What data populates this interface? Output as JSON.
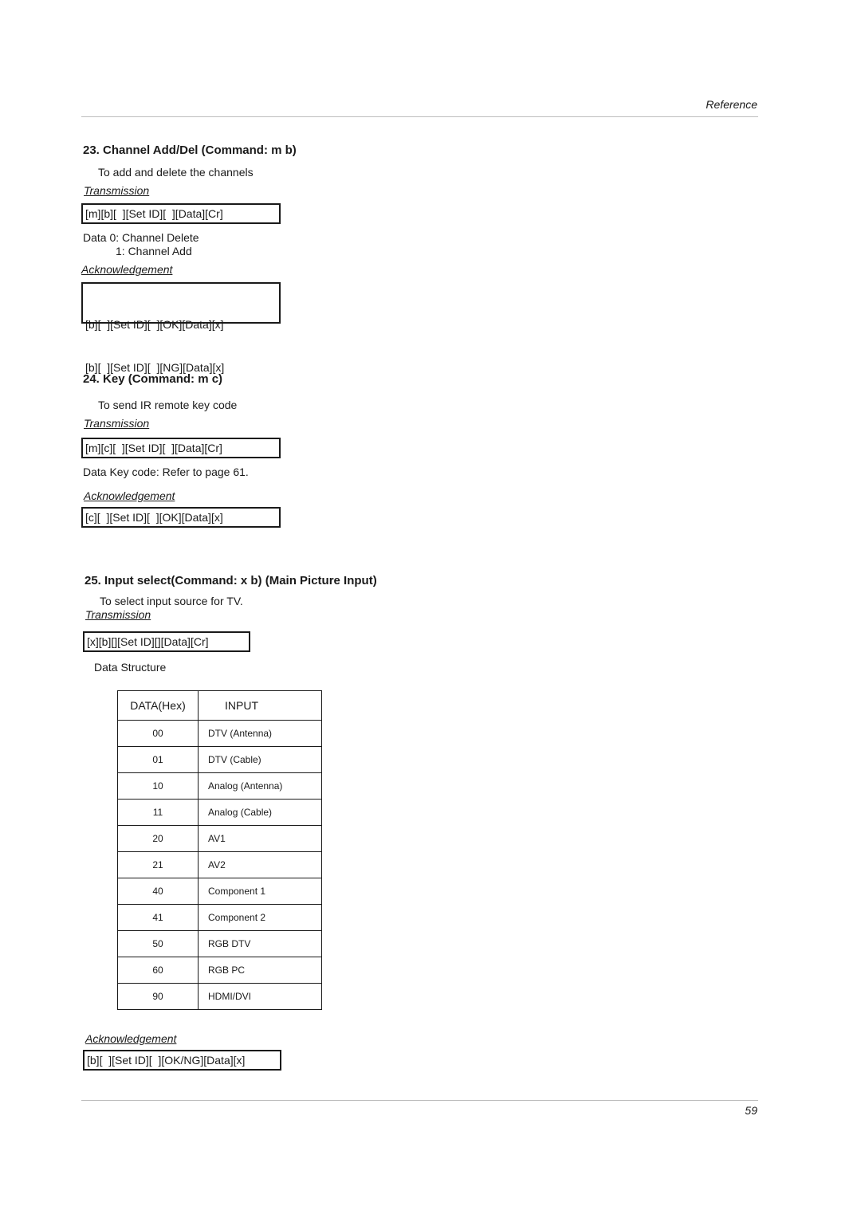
{
  "header": {
    "section": "Reference"
  },
  "footer": {
    "page_number": "59"
  },
  "sections": [
    {
      "title": "23. Channel Add/Del (Command: m b)",
      "description": "To add and delete the channels",
      "transmission_label": "Transmission",
      "transmission": "[m][b][  ][Set ID][  ][Data][Cr]",
      "data_lines": [
        "Data  0: Channel Delete",
        "1: Channel Add"
      ],
      "ack_label": "Acknowledgement",
      "ack_lines": [
        "[b][  ][Set ID][  ][OK][Data][x]",
        "[b][  ][Set ID][  ][NG][Data][x]"
      ]
    },
    {
      "title": "24. Key (Command: m c)",
      "description": "To send IR remote key code",
      "transmission_label": "Transmission",
      "transmission": "[m][c][  ][Set ID][  ][Data][Cr]",
      "data_lines": [
        "Data  Key code: Refer to page 61."
      ],
      "ack_label": "Acknowledgement",
      "ack_lines": [
        "[c][  ][Set ID][  ][OK][Data][x]"
      ]
    },
    {
      "title": "25. Input select(Command: x b) (Main Picture Input)",
      "description": "To select input source for TV.",
      "transmission_label": "Transmission",
      "transmission": "[x][b][][Set ID][][Data][Cr]",
      "data_structure_label": "Data Structure",
      "table": {
        "headers": [
          "DATA(Hex)",
          "INPUT"
        ],
        "rows": [
          [
            "00",
            "DTV (Antenna)"
          ],
          [
            "01",
            "DTV (Cable)"
          ],
          [
            "10",
            "Analog (Antenna)"
          ],
          [
            "11",
            "Analog (Cable)"
          ],
          [
            "20",
            "AV1"
          ],
          [
            "21",
            "AV2"
          ],
          [
            "40",
            "Component 1"
          ],
          [
            "41",
            "Component 2"
          ],
          [
            "50",
            "RGB DTV"
          ],
          [
            "60",
            "RGB PC"
          ],
          [
            "90",
            "HDMI/DVI"
          ]
        ]
      },
      "ack_label": "Acknowledgement",
      "ack_lines": [
        "[b][  ][Set ID][  ][OK/NG][Data][x]"
      ]
    }
  ]
}
